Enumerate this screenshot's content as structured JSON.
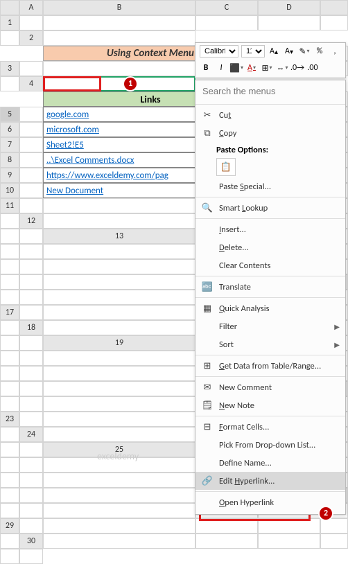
{
  "columns": [
    "A",
    "B",
    "C",
    "D"
  ],
  "row_count": 30,
  "selected_row": 5,
  "title": "Using Context Menu",
  "links_header": "Links",
  "links": [
    "google.com",
    "microsoft.com",
    "Sheet2!E5",
    "..\\Excel Comments.docx",
    "https://www.exceldemy.com/pag",
    "New Document"
  ],
  "callouts": {
    "c1": "1",
    "c2": "2"
  },
  "mini_toolbar": {
    "font": "Calibri",
    "size": "11",
    "inc": "A▴",
    "dec": "A▾",
    "bold": "B",
    "italic": "I",
    "fill": "⬛",
    "font_color": "A",
    "border": "⊞",
    "merge": "⍃",
    "format_painter": "✎",
    "percent": "%",
    "comma": ","
  },
  "search_placeholder": "Search the menus",
  "context_menu": [
    {
      "type": "item",
      "icon": "✂",
      "label": "Cut",
      "u": "t"
    },
    {
      "type": "item",
      "icon": "⧉",
      "label": "Copy",
      "u": "C"
    },
    {
      "type": "head",
      "label": "Paste Options:"
    },
    {
      "type": "paste"
    },
    {
      "type": "item",
      "icon": "",
      "label": "Paste Special...",
      "u": "S"
    },
    {
      "type": "sep"
    },
    {
      "type": "item",
      "icon": "🔍",
      "label": "Smart Lookup",
      "u": "L"
    },
    {
      "type": "sep"
    },
    {
      "type": "item",
      "icon": "",
      "label": "Insert...",
      "u": "I"
    },
    {
      "type": "item",
      "icon": "",
      "label": "Delete...",
      "u": "D"
    },
    {
      "type": "item",
      "icon": "",
      "label": "Clear Contents",
      "u": "N"
    },
    {
      "type": "sep"
    },
    {
      "type": "item",
      "icon": "🔤",
      "label": "Translate"
    },
    {
      "type": "sep"
    },
    {
      "type": "item",
      "icon": "▦",
      "label": "Quick Analysis",
      "u": "Q"
    },
    {
      "type": "item",
      "icon": "",
      "label": "Filter",
      "u": "E",
      "sub": "▶"
    },
    {
      "type": "item",
      "icon": "",
      "label": "Sort",
      "u": "O",
      "sub": "▶"
    },
    {
      "type": "sep"
    },
    {
      "type": "item",
      "icon": "⊞",
      "label": "Get Data from Table/Range...",
      "u": "G"
    },
    {
      "type": "sep"
    },
    {
      "type": "item",
      "icon": "✉",
      "label": "New Comment",
      "u": "M"
    },
    {
      "type": "item",
      "icon": "🗒",
      "label": "New Note",
      "u": "N"
    },
    {
      "type": "sep"
    },
    {
      "type": "item",
      "icon": "⊟",
      "label": "Format Cells...",
      "u": "F"
    },
    {
      "type": "item",
      "icon": "",
      "label": "Pick From Drop-down List...",
      "u": "K"
    },
    {
      "type": "item",
      "icon": "",
      "label": "Define Name...",
      "u": "A"
    },
    {
      "type": "item",
      "icon": "🔗",
      "label": "Edit Hyperlink...",
      "u": "H",
      "highlight": true
    },
    {
      "type": "sep"
    },
    {
      "type": "item",
      "icon": "",
      "label": "Open Hyperlink",
      "u": "O"
    }
  ],
  "paste_icon": "📋",
  "watermark": "exceldemy"
}
